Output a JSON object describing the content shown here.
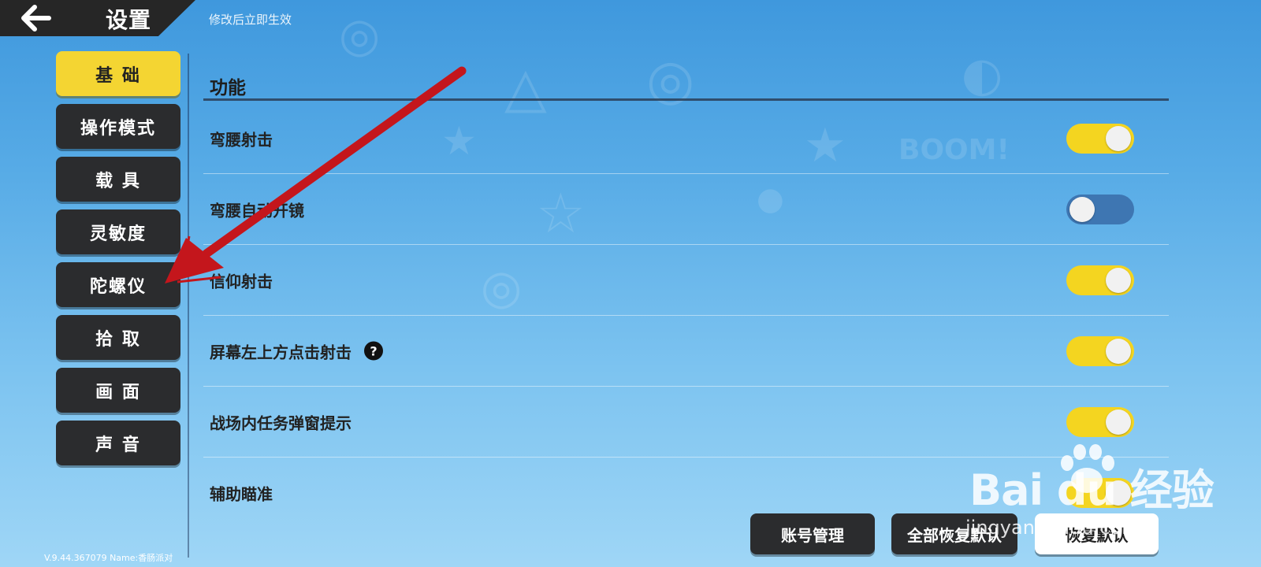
{
  "header": {
    "title": "设置",
    "note": "修改后立即生效"
  },
  "sidebar": {
    "items": [
      {
        "label": "基 础",
        "active": true
      },
      {
        "label": "操作模式",
        "active": false
      },
      {
        "label": "载 具",
        "active": false
      },
      {
        "label": "灵敏度",
        "active": false
      },
      {
        "label": "陀螺仪",
        "active": false
      },
      {
        "label": "拾 取",
        "active": false
      },
      {
        "label": "画 面",
        "active": false
      },
      {
        "label": "声 音",
        "active": false
      }
    ]
  },
  "main": {
    "section_title": "功能",
    "settings": [
      {
        "label": "弯腰射击",
        "state": "on"
      },
      {
        "label": "弯腰自动开镜",
        "state": "off"
      },
      {
        "label": "信仰射击",
        "state": "on"
      },
      {
        "label": "屏幕左上方点击射击",
        "state": "on",
        "help": "?"
      },
      {
        "label": "战场内任务弹窗提示",
        "state": "on"
      },
      {
        "label": "辅助瞄准",
        "state": "on"
      }
    ]
  },
  "footer": {
    "version": "V.9.44.367079 Name:香肠派对",
    "account_button": "账号管理",
    "restore_all_button": "全部恢复默认",
    "restore_button": "恢复默认"
  },
  "watermark": {
    "main": "Bai du 经验",
    "sub": "jingyan.baidu.com"
  },
  "colors": {
    "toggle_on": "#f4d520",
    "toggle_off": "#3e76b2",
    "active_tab": "#f4d532",
    "dark_button": "#2b2c2e",
    "annotation_arrow": "#c4161c"
  }
}
